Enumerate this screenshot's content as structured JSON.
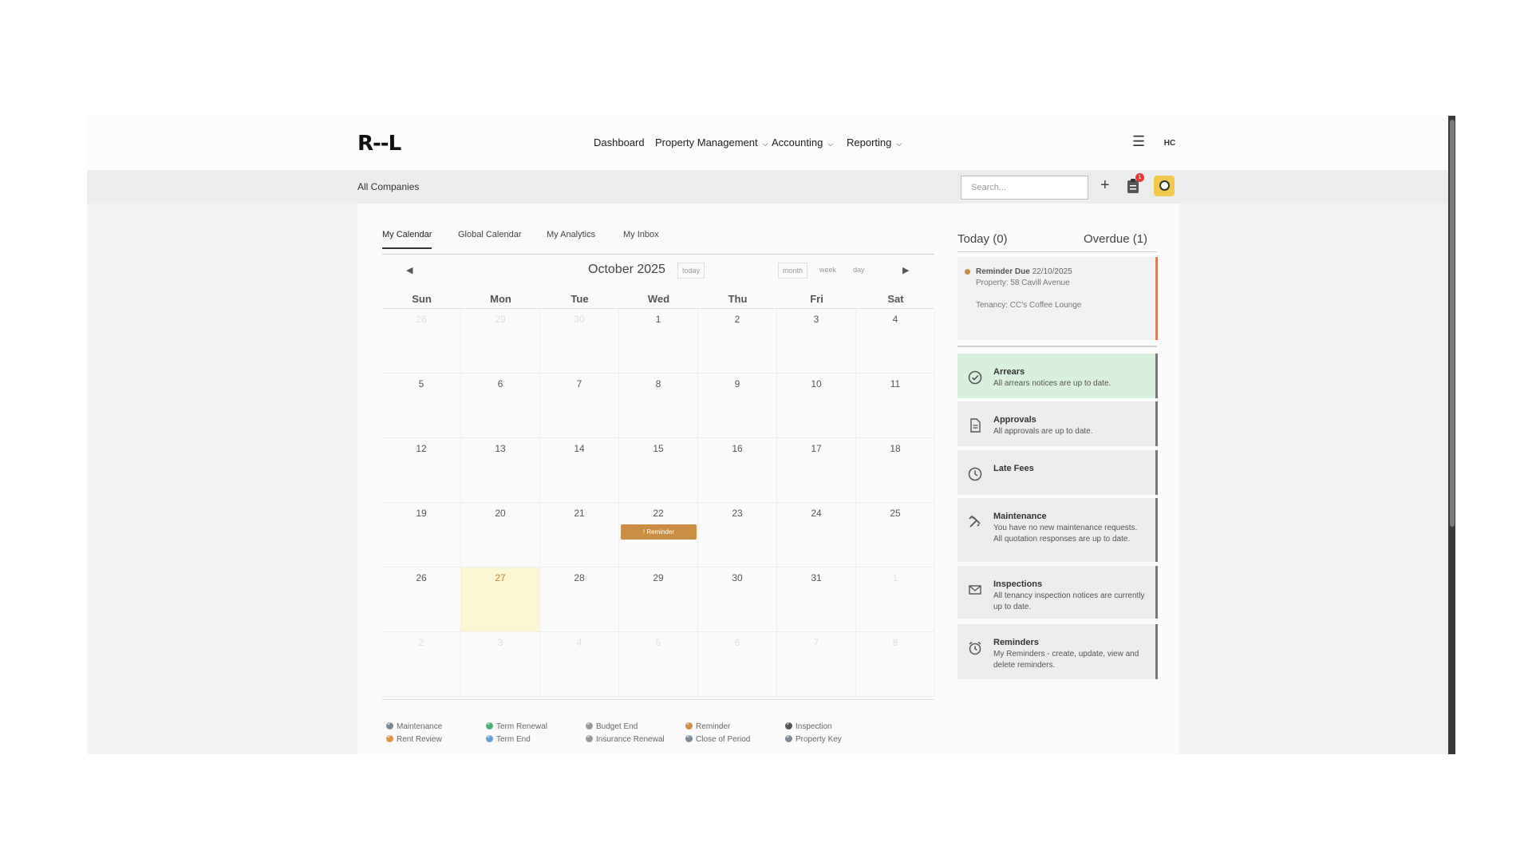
{
  "app": {
    "logo": "R--L"
  },
  "nav": {
    "dashboard": "Dashboard",
    "property_management": "Property Management",
    "accounting": "Accounting",
    "reporting": "Reporting",
    "user_initials": "HC"
  },
  "subbar": {
    "company": "All Companies",
    "search_placeholder": "Search...",
    "notification_count": "1"
  },
  "tabs": [
    "My Calendar",
    "Global Calendar",
    "My Analytics",
    "My Inbox"
  ],
  "calendar": {
    "month_title": "October 2025",
    "today_label": "today",
    "views": [
      "month",
      "week",
      "day"
    ],
    "days_of_week": [
      "Sun",
      "Mon",
      "Tue",
      "Wed",
      "Thu",
      "Fri",
      "Sat"
    ],
    "weeks": [
      [
        {
          "d": "28",
          "o": true
        },
        {
          "d": "29",
          "o": true
        },
        {
          "d": "30",
          "o": true
        },
        {
          "d": "1"
        },
        {
          "d": "2"
        },
        {
          "d": "3"
        },
        {
          "d": "4"
        }
      ],
      [
        {
          "d": "5"
        },
        {
          "d": "6"
        },
        {
          "d": "7"
        },
        {
          "d": "8"
        },
        {
          "d": "9"
        },
        {
          "d": "10"
        },
        {
          "d": "11"
        }
      ],
      [
        {
          "d": "12"
        },
        {
          "d": "13"
        },
        {
          "d": "14"
        },
        {
          "d": "15"
        },
        {
          "d": "16"
        },
        {
          "d": "17"
        },
        {
          "d": "18"
        }
      ],
      [
        {
          "d": "19"
        },
        {
          "d": "20"
        },
        {
          "d": "21"
        },
        {
          "d": "22",
          "event": "! Reminder"
        },
        {
          "d": "23"
        },
        {
          "d": "24"
        },
        {
          "d": "25"
        }
      ],
      [
        {
          "d": "26"
        },
        {
          "d": "27",
          "today": true
        },
        {
          "d": "28"
        },
        {
          "d": "29"
        },
        {
          "d": "30"
        },
        {
          "d": "31"
        },
        {
          "d": "1",
          "o": true
        }
      ],
      [
        {
          "d": "2",
          "o": true
        },
        {
          "d": "3",
          "o": true
        },
        {
          "d": "4",
          "o": true
        },
        {
          "d": "5",
          "o": true
        },
        {
          "d": "6",
          "o": true
        },
        {
          "d": "7",
          "o": true
        },
        {
          "d": "8",
          "o": true
        }
      ]
    ],
    "today_color": "#fbf6d2",
    "event_color": "#c98d44"
  },
  "legend": [
    {
      "label": "Maintenance",
      "color": "#7e8a98"
    },
    {
      "label": "Term Renewal",
      "color": "#4caf76"
    },
    {
      "label": "Budget End",
      "color": "#9a9a9a"
    },
    {
      "label": "Reminder",
      "color": "#c98d44"
    },
    {
      "label": "Inspection",
      "color": "#555555"
    },
    {
      "label": "Rent Review",
      "color": "#e0964a"
    },
    {
      "label": "Term End",
      "color": "#6a9fd6"
    },
    {
      "label": "Insurance Renewal",
      "color": "#9a9a9a"
    },
    {
      "label": "Close of Period",
      "color": "#7e8a98"
    },
    {
      "label": "Property Key",
      "color": "#7e8a98"
    }
  ],
  "right_panel": {
    "today": "Today (0)",
    "overdue": "Overdue (1)",
    "reminder": {
      "due_label": "Reminder Due",
      "due_date": "22/10/2025",
      "property": "Property: 58 Cavill Avenue",
      "tenancy": "Tenancy: CC's Coffee Lounge"
    },
    "cards": [
      {
        "title": "Arrears",
        "desc": "All arrears notices are up to date.",
        "icon": "check-circle-icon"
      },
      {
        "title": "Approvals",
        "desc": "All approvals are up to date.",
        "icon": "document-icon"
      },
      {
        "title": "Late Fees",
        "desc": "",
        "icon": "clock-icon"
      },
      {
        "title": "Maintenance",
        "desc": "You have no new maintenance requests.\nAll quotation responses are up to date.",
        "icon": "tools-icon"
      },
      {
        "title": "Inspections",
        "desc": "All tenancy inspection notices are currently up to date.",
        "icon": "envelope-icon"
      },
      {
        "title": "Reminders",
        "desc": "My Reminders - create, update, view and delete reminders.",
        "icon": "alarm-clock-icon"
      }
    ]
  }
}
